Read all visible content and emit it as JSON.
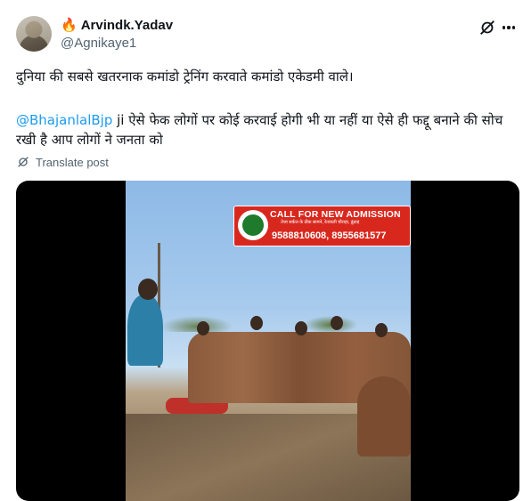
{
  "author": {
    "display_name": "Arvindk.Yadav",
    "handle": "@Agnikaye1",
    "badge_icon": "fire-emoji-icon"
  },
  "post": {
    "line1": "दुनिया की सबसे खतरनाक कमांडो ट्रेनिंग करवाते कमांडो एकेडमी वाले।",
    "mention": "@BhajanlalBjp",
    "body2": " ji ऐसे फेक लोगों पर कोई करवाई होगी भी या नहीं या ऐसे ही फद्दू बनाने की सोच रखी है आप लोगों ने जनता को"
  },
  "translate_label": "Translate post",
  "media": {
    "banner_title": "CALL FOR NEW ADMISSION",
    "banner_subtitle": "तेजा सर्कल के ठीक सामने, रेतवाली चौराहा, ढूंढाड़",
    "banner_phone": "9588810608, 8955681577"
  },
  "colors": {
    "link": "#1d9bf0",
    "muted": "#536471",
    "banner": "#d8281e"
  }
}
